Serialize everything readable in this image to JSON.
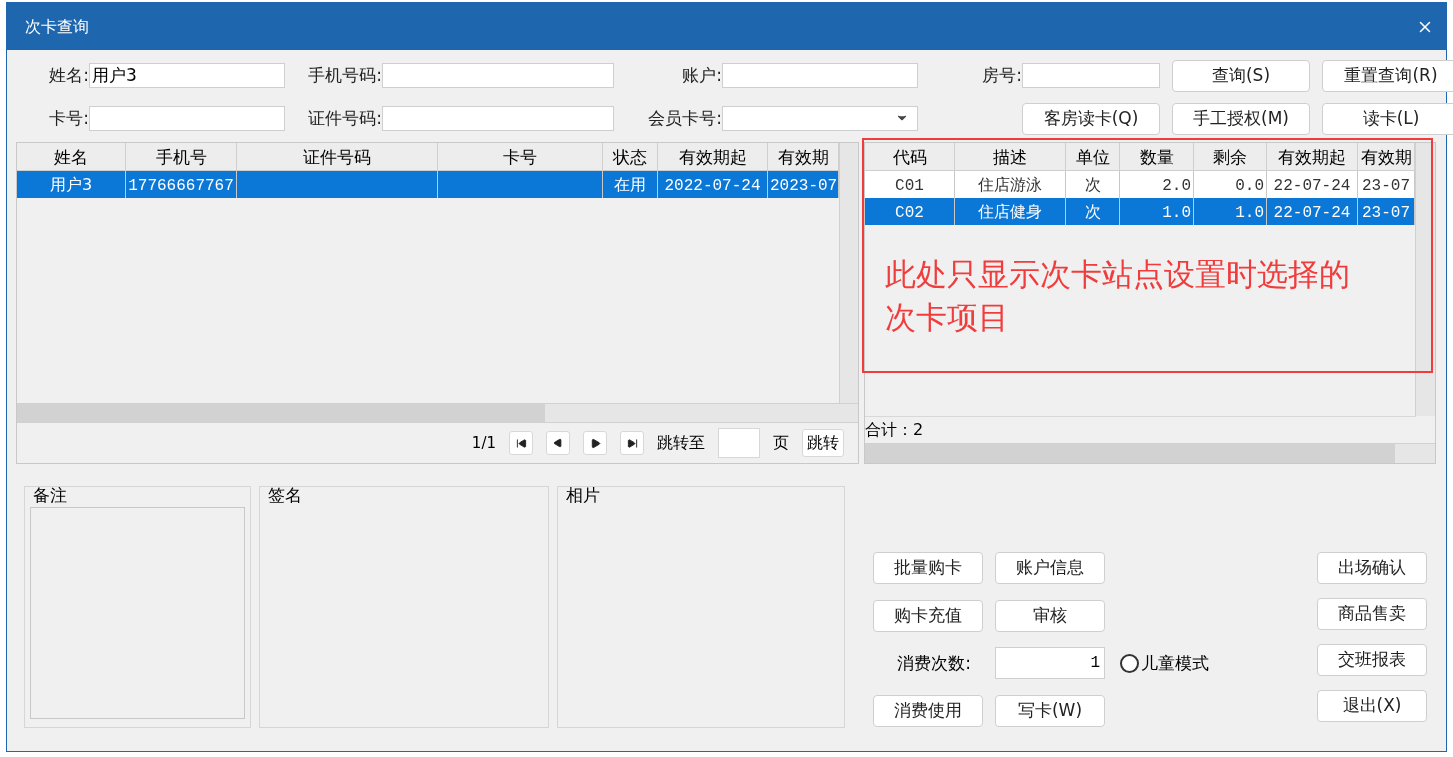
{
  "window": {
    "title": "次卡查询"
  },
  "search_form": {
    "fields": [
      {
        "kind": "text",
        "label": "姓名:",
        "value": "用户3"
      },
      {
        "kind": "text",
        "label": "手机号码:"
      },
      {
        "kind": "text",
        "label": "账户:"
      },
      {
        "kind": "text",
        "label": "房号:"
      },
      {
        "kind": "text",
        "label": "卡号:"
      },
      {
        "kind": "text",
        "label": "证件号码:"
      },
      {
        "kind": "dropdown",
        "label": "会员卡号:"
      }
    ],
    "buttons": [
      {
        "label": "查询(S)"
      },
      {
        "label": "重置查询(R)"
      },
      {
        "label": "客房读卡(Q)"
      },
      {
        "label": "手工授权(M)"
      },
      {
        "label": "读卡(L)"
      }
    ]
  },
  "cards_table": {
    "columns": [
      "姓名",
      "手机号",
      "证件号码",
      "卡号",
      "状态",
      "有效期起",
      "有效期"
    ],
    "rows": [
      {
        "selected": true,
        "cells": [
          "用户3",
          "17766667767",
          "",
          "",
          "在用",
          "2022-07-24",
          "2023-07"
        ]
      }
    ],
    "pager": {
      "page": "1/1",
      "jump_label": "跳转至",
      "page_unit": "页",
      "jump_button": "跳转"
    }
  },
  "items_table": {
    "columns": [
      "代码",
      "描述",
      "单位",
      "数量",
      "剩余",
      "有效期起",
      "有效期"
    ],
    "rows": [
      {
        "selected": false,
        "cells": [
          "C01",
          "住店游泳",
          "次",
          "2.0",
          "0.0",
          "22-07-24",
          "23-07"
        ]
      },
      {
        "selected": true,
        "cells": [
          "C02",
          "住店健身",
          "次",
          "1.0",
          "1.0",
          "22-07-24",
          "23-07"
        ]
      }
    ],
    "total": "合计：2"
  },
  "annotation": "此处只显示次卡站点设置时选择的次卡项目",
  "panels": [
    "备注",
    "签名",
    "相片"
  ],
  "actions": {
    "left_buttons": [
      {
        "label": "批量购卡"
      },
      {
        "label": "账户信息"
      },
      {
        "label": "购卡充值"
      },
      {
        "label": "审核"
      }
    ],
    "count_label": "消费次数:",
    "count_value": "1",
    "child_mode": {
      "label": "儿童模式",
      "checked": false
    },
    "bottom_buttons": [
      {
        "label": "消费使用"
      },
      {
        "label": "写卡(W)"
      }
    ],
    "right_buttons": [
      {
        "label": "出场确认"
      },
      {
        "label": "商品售卖"
      },
      {
        "label": "交班报表"
      },
      {
        "label": "退出(X)"
      }
    ]
  }
}
